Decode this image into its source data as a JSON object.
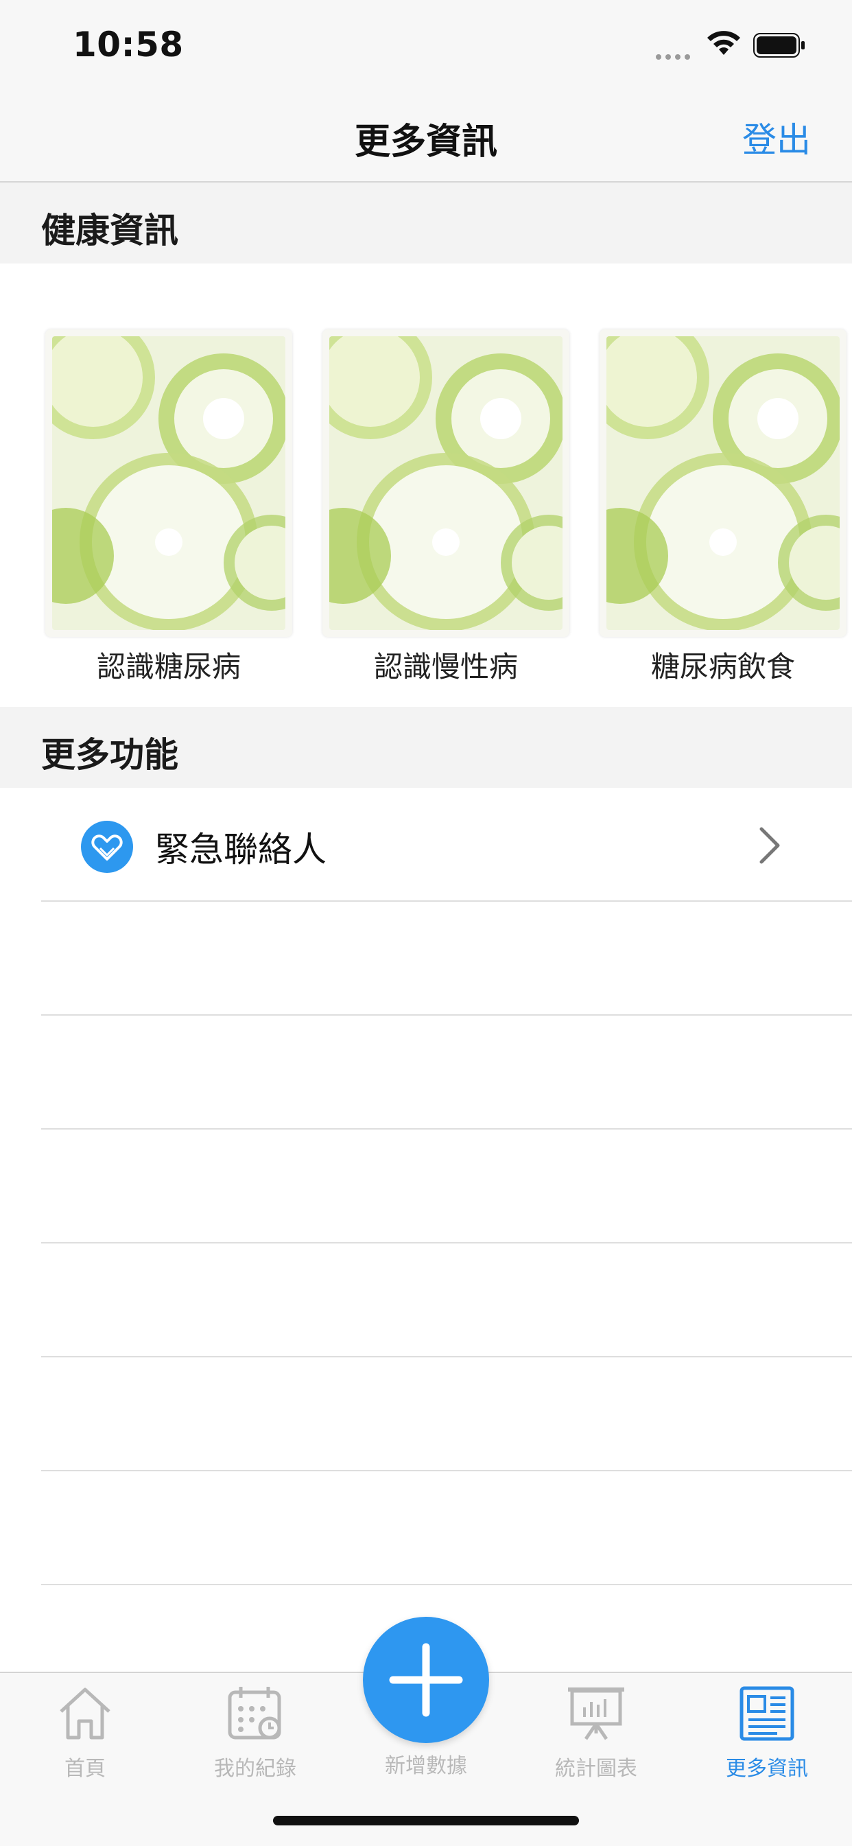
{
  "status": {
    "time": "10:58"
  },
  "nav": {
    "title": "更多資訊",
    "right_action": "登出"
  },
  "sections": {
    "health": "健康資訊",
    "more": "更多功能"
  },
  "cards": [
    {
      "caption": "認識糖尿病"
    },
    {
      "caption": "認識慢性病"
    },
    {
      "caption": "糖尿病飲食"
    }
  ],
  "list": [
    {
      "label": "緊急聯絡人",
      "icon": "heart-hands-icon"
    }
  ],
  "tabs": [
    {
      "label": "首頁",
      "icon": "home-icon"
    },
    {
      "label": "我的紀錄",
      "icon": "calendar-icon"
    },
    {
      "label": "新增數據",
      "icon": "plus-icon"
    },
    {
      "label": "統計圖表",
      "icon": "presentation-chart-icon"
    },
    {
      "label": "更多資訊",
      "icon": "newspaper-icon"
    }
  ],
  "colors": {
    "accent": "#2a8be6",
    "inactive": "#b8b8b8",
    "fab": "#2e97f0"
  }
}
